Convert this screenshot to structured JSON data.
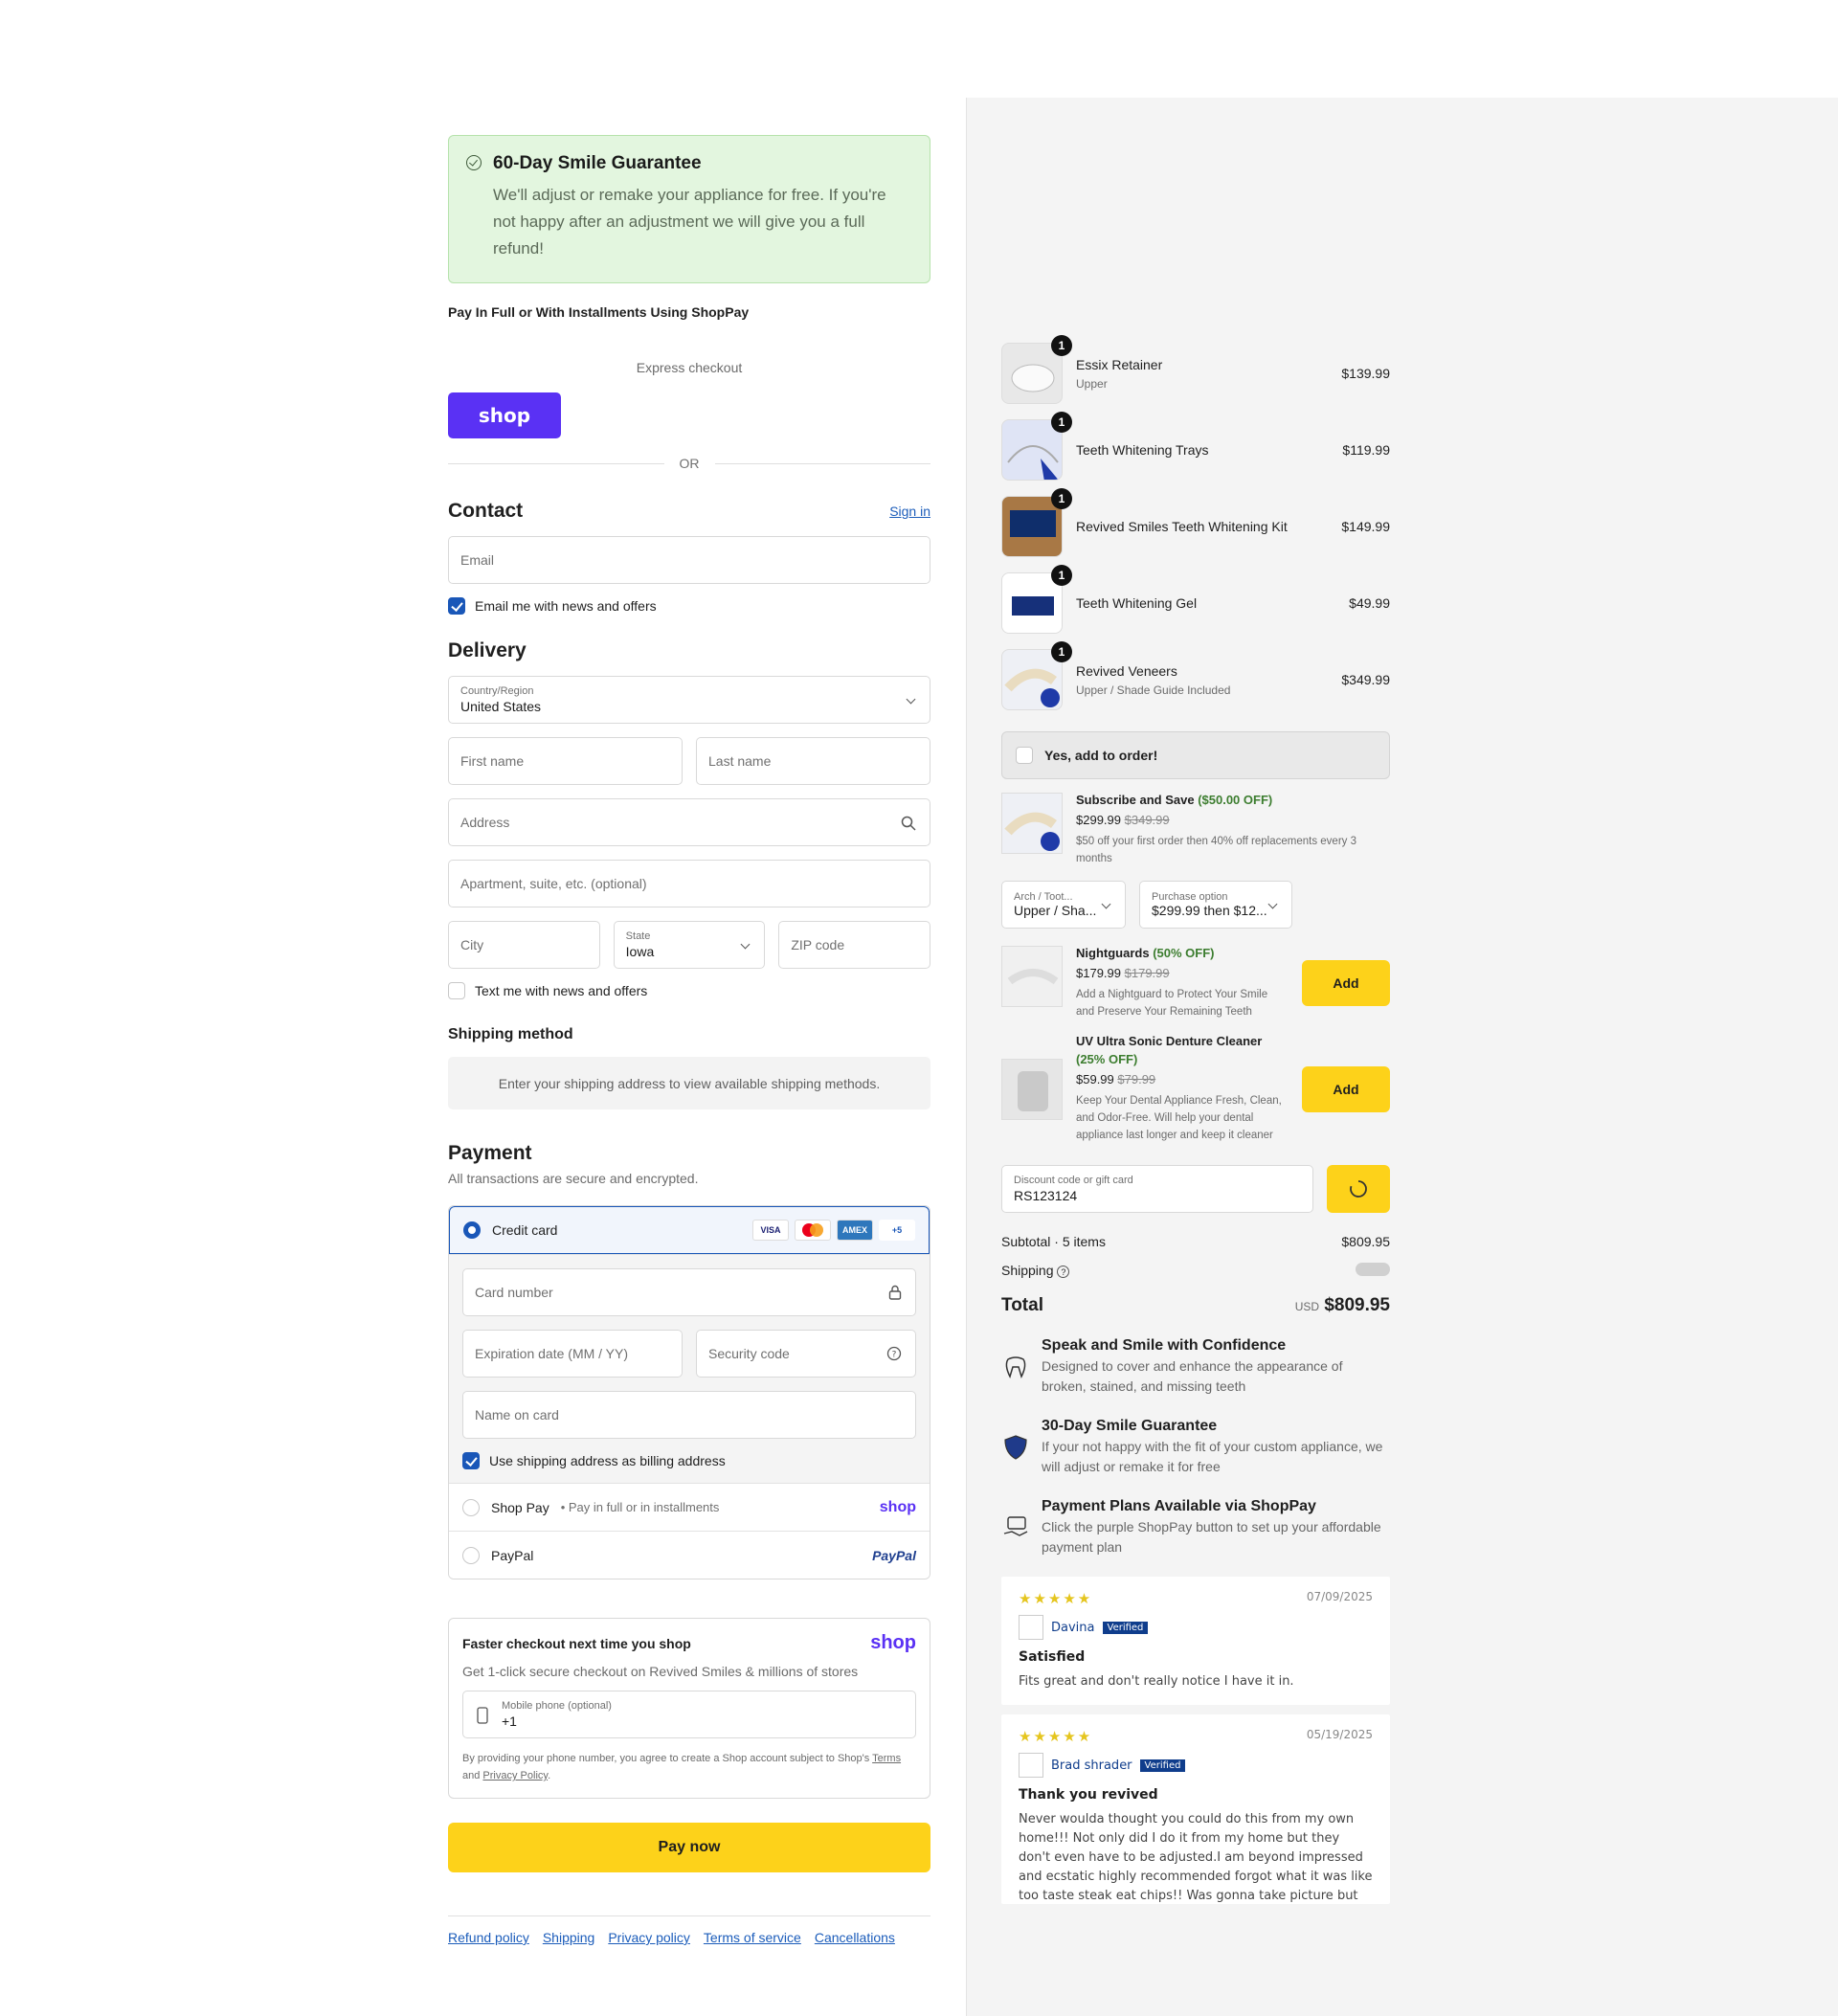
{
  "guarantee": {
    "title": "60-Day Smile Guarantee",
    "text": "We'll adjust or remake your appliance for free. If you're not happy after an adjustment we will give you a full refund!"
  },
  "pay_full_label": "Pay In Full or With Installments Using ShopPay",
  "express_checkout": "Express checkout",
  "shop_button": "shop",
  "or_label": "OR",
  "contact": {
    "title": "Contact",
    "sign_in": "Sign in",
    "email_placeholder": "Email",
    "news_label": "Email me with news and offers"
  },
  "delivery": {
    "title": "Delivery",
    "country_label": "Country/Region",
    "country_value": "United States",
    "first_name": "First name",
    "last_name": "Last name",
    "address": "Address",
    "apartment": "Apartment, suite, etc. (optional)",
    "city": "City",
    "state_label": "State",
    "state_value": "Iowa",
    "zip": "ZIP code",
    "text_label": "Text me with news and offers"
  },
  "shipping": {
    "title": "Shipping method",
    "note": "Enter your shipping address to view available shipping methods."
  },
  "payment": {
    "title": "Payment",
    "subtitle": "All transactions are secure and encrypted.",
    "credit_card": "Credit card",
    "card_brands": [
      "VISA",
      "MC",
      "AMEX",
      "+5"
    ],
    "card_number": "Card number",
    "expiration": "Expiration date (MM / YY)",
    "security": "Security code",
    "name_on_card": "Name on card",
    "billing_label": "Use shipping address as billing address",
    "shop_pay": "Shop Pay",
    "shop_pay_sub": "• Pay in full or in installments",
    "shop_logo": "shop",
    "paypal": "PayPal",
    "paypal_logo": "PayPal"
  },
  "faster": {
    "title": "Faster checkout next time you shop",
    "logo": "shop",
    "subtitle": "Get 1-click secure checkout on Revived Smiles & millions of stores",
    "phone_label": "Mobile phone (optional)",
    "phone_value": "+1",
    "legal_prefix": "By providing your phone number, you agree to create a Shop account subject to Shop's",
    "terms": "Terms",
    "and": "and",
    "privacy": "Privacy Policy",
    "period": "."
  },
  "pay_now": "Pay now",
  "footer_links": [
    "Refund policy",
    "Shipping",
    "Privacy policy",
    "Terms of service",
    "Cancellations"
  ],
  "cart": {
    "items": [
      {
        "name": "Essix Retainer",
        "variant": "Upper",
        "price": "$139.99",
        "qty": "1"
      },
      {
        "name": "Teeth Whitening Trays",
        "variant": "",
        "price": "$119.99",
        "qty": "1"
      },
      {
        "name": "Revived Smiles Teeth Whitening Kit",
        "variant": "",
        "price": "$149.99",
        "qty": "1"
      },
      {
        "name": "Teeth Whitening Gel",
        "variant": "",
        "price": "$49.99",
        "qty": "1"
      },
      {
        "name": "Revived Veneers",
        "variant": "Upper / Shade Guide Included",
        "price": "$349.99",
        "qty": "1"
      }
    ],
    "add_to_order": "Yes, add to order!",
    "subscribe": {
      "title": "Subscribe and Save",
      "off": "($50.00 OFF)",
      "price": "$299.99",
      "old_price": "$349.99",
      "desc": "$50 off your first order then 40% off replacements every 3 months",
      "select1_label": "Arch / Toot...",
      "select1_value": "Upper / Sha...",
      "select2_label": "Purchase option",
      "select2_value": "$299.99 then $12..."
    },
    "upsells": [
      {
        "title": "Nightguards",
        "off": "(50% OFF)",
        "price": "$179.99",
        "old_price": "$179.99",
        "desc": "Add a Nightguard to Protect Your Smile and Preserve Your Remaining Teeth",
        "button": "Add"
      },
      {
        "title": "UV Ultra Sonic Denture Cleaner",
        "off": "(25% OFF)",
        "price": "$59.99",
        "old_price": "$79.99",
        "desc": "Keep Your Dental Appliance Fresh, Clean, and Odor-Free. Will help your dental appliance last longer and keep it cleaner",
        "button": "Add"
      }
    ],
    "discount_label": "Discount code or gift card",
    "discount_value": "RS123124",
    "subtotal_label": "Subtotal · 5 items",
    "subtotal": "$809.95",
    "shipping_label": "Shipping",
    "total_label": "Total",
    "currency": "USD",
    "total": "$809.95"
  },
  "features": [
    {
      "title": "Speak and Smile with Confidence",
      "text": "Designed to cover and enhance the appearance of broken, stained, and missing teeth",
      "icon": "tooth-icon"
    },
    {
      "title": "30-Day Smile Guarantee",
      "text": "If your not happy with the fit of your custom appliance, we will adjust or remake it for free",
      "icon": "shield-icon"
    },
    {
      "title": "Payment Plans Available via ShopPay",
      "text": "Click the purple ShopPay button to set up your affordable payment plan",
      "icon": "payment-hand-icon"
    }
  ],
  "reviews": [
    {
      "stars": "★★★★★",
      "date": "07/09/2025",
      "name": "Davina",
      "verified": "Verified",
      "title": "Satisfied",
      "text": "Fits great and don't really notice I have it in."
    },
    {
      "stars": "★★★★★",
      "date": "05/19/2025",
      "name": "Brad shrader",
      "verified": "Verified",
      "title": "Thank you revived",
      "text": "Never woulda thought you could do this from my own home!!! Not only did I do it from my home but they don't even have to be adjusted.I am beyond impressed and ecstatic highly recommended forgot what it was like too taste steak eat chips!! Was gonna take picture but"
    }
  ]
}
